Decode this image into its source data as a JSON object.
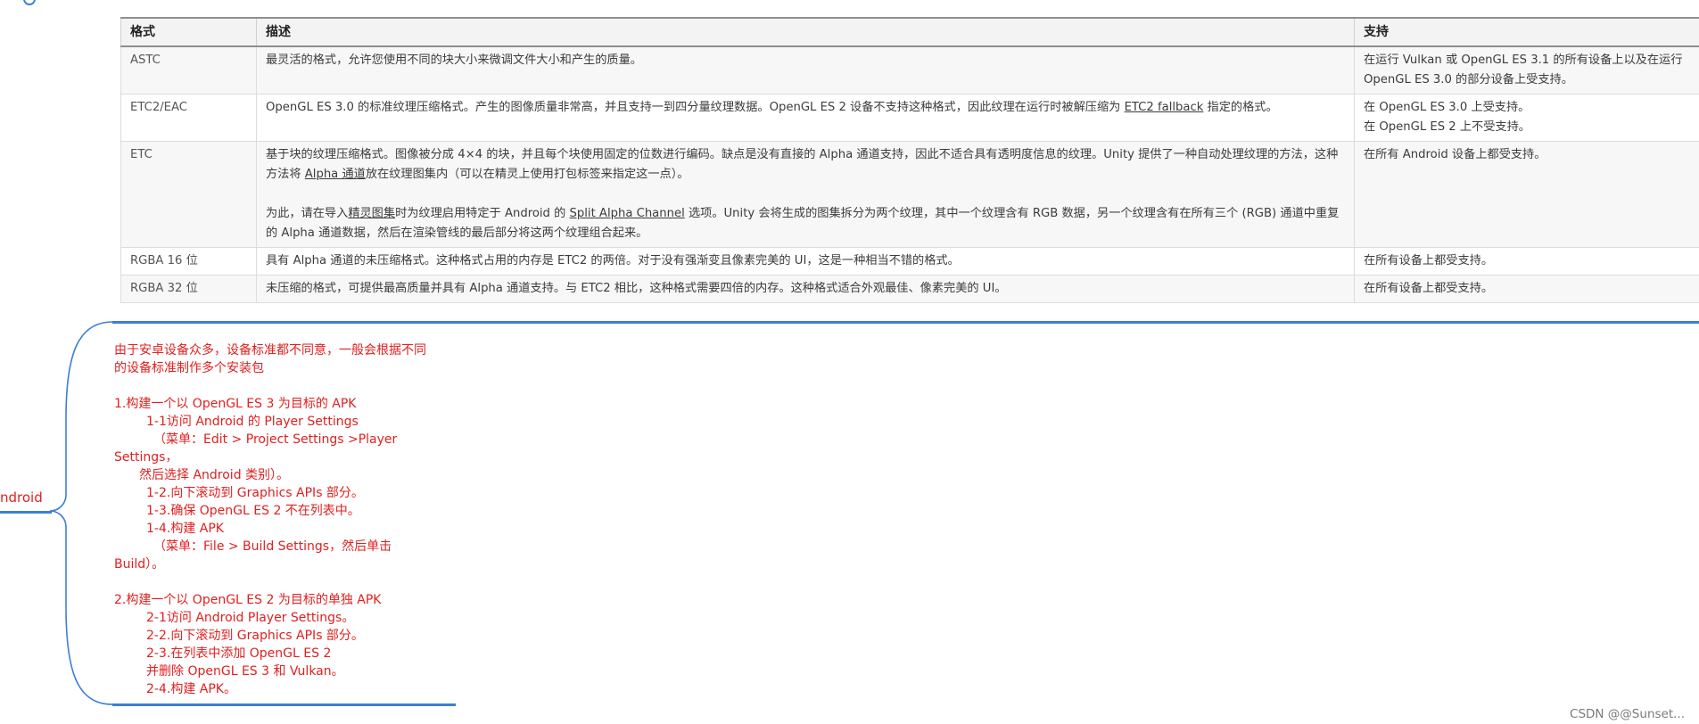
{
  "table": {
    "headers": [
      "格式",
      "描述",
      "支持"
    ],
    "rows": [
      {
        "format": "ASTC",
        "desc": [
          "最灵活的格式，允许您使用不同的块大小来微调文件大小和产生的质量。"
        ],
        "support": [
          "在运行 Vulkan 或 OpenGL ES 3.1 的所有设备上以及在运行",
          "OpenGL ES 3.0 的部分设备上受支持。"
        ]
      },
      {
        "format": "ETC2/EAC",
        "desc_pre": "OpenGL ES 3.0 的标准纹理压缩格式。产生的图像质量非常高，并且支持一到四分量纹理数据。OpenGL ES 2 设备不支持这种格式，因此纹理在运行时被解压缩为 ",
        "desc_link": "ETC2 fallback",
        "desc_post": " 指定的格式。",
        "support": [
          "在 OpenGL ES 3.0 上受支持。",
          "在 OpenGL ES 2 上不受支持。"
        ]
      },
      {
        "format": "ETC",
        "desc_p1_pre": "基于块的纹理压缩格式。图像被分成 4×4 的块，并且每个块使用固定的位数进行编码。缺点是没有直接的 Alpha 通道支持，因此不适合具有透明度信息的纹理。Unity 提供了一种自动处理纹理的方法，这种方法将 ",
        "desc_p1_link": "Alpha 通道",
        "desc_p1_post": "放在纹理图集内（可以在精灵上使用打包标签来指定这一点）。",
        "desc_p2_a": "为此，请在导入",
        "desc_p2_link1": "精灵图集",
        "desc_p2_b": "时为纹理启用特定于 Android 的 ",
        "desc_p2_link2": "Split Alpha Channel",
        "desc_p2_c": " 选项。Unity 会将生成的图集拆分为两个纹理，其中一个纹理含有 RGB 数据，另一个纹理含有在所有三个 (RGB) 通道中重复的 Alpha 通道数据，然后在渲染管线的最后部分将这两个纹理组合起来。",
        "support": [
          "在所有 Android 设备上都受支持。"
        ]
      },
      {
        "format": "RGBA 16 位",
        "desc": [
          "具有 Alpha 通道的未压缩格式。这种格式占用的内存是 ETC2 的两倍。对于没有强渐变且像素完美的 UI，这是一种相当不错的格式。"
        ],
        "support": [
          "在所有设备上都受支持。"
        ]
      },
      {
        "format": "RGBA 32 位",
        "desc": [
          "未压缩的格式，可提供最高质量并具有 Alpha 通道支持。与 ETC2 相比，这种格式需要四倍的内存。这种格式适合外观最佳、像素完美的 UI。"
        ],
        "support": [
          "在所有设备上都受支持。"
        ]
      }
    ]
  },
  "mindmap": {
    "root_label": "ndroid",
    "line_color": "#3b7fd4",
    "text_color": "#e02020",
    "intro": [
      "由于安卓设备众多，设备标准都不同意，一般会根据不同",
      "的设备标准制作多个安装包"
    ],
    "s1": {
      "title": "1.构建一个以 OpenGL ES 3 为目标的 APK",
      "l1": "1-1访问 Android 的 Player Settings",
      "l2": "（菜单：Edit > Project Settings >Player",
      "l3": "Settings，",
      "l4": "然后选择 Android     类别）。",
      "l5": "1-2.向下滚动到 Graphics APIs 部分。",
      "l6": "1-3.确保 OpenGL ES 2 不在列表中。",
      "l7": "1-4.构建 APK",
      "l8": "（菜单：File > Build Settings，然后单击",
      "l9": "Build）。"
    },
    "s2": {
      "title": "2.构建一个以 OpenGL ES 2 为目标的单独 APK",
      "l1": "2-1访问 Android Player Settings。",
      "l2": "2-2.向下滚动到 Graphics APIs 部分。",
      "l3": "2-3.在列表中添加 OpenGL ES 2",
      "l4": "并删除 OpenGL ES 3 和 Vulkan。",
      "l5": "2-4.构建 APK。"
    }
  },
  "watermark": "CSDN @@Sunset..."
}
